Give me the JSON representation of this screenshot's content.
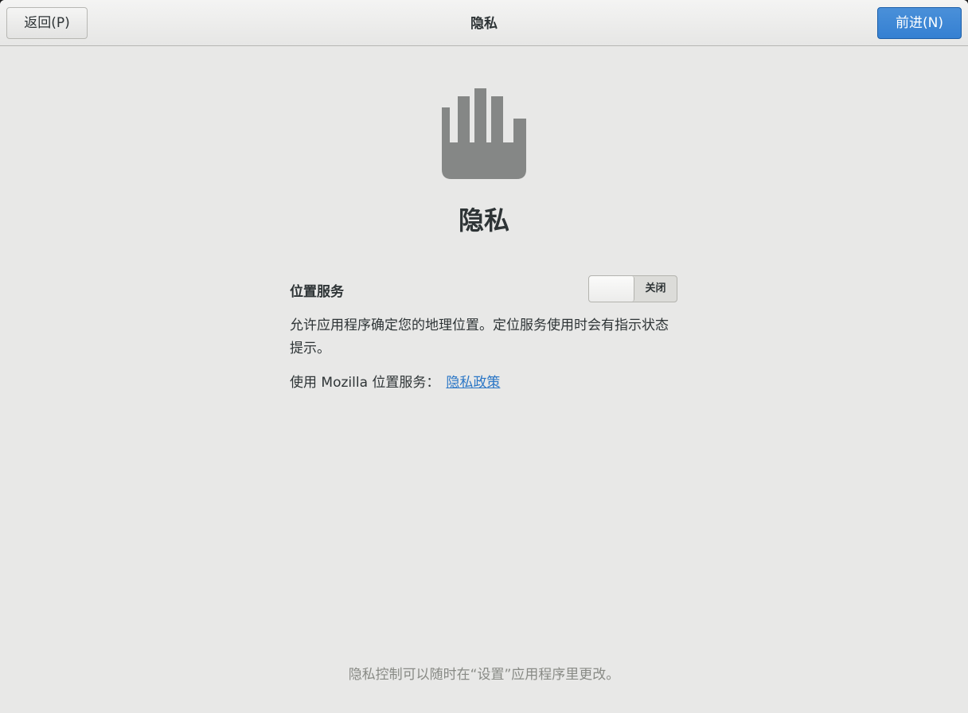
{
  "header": {
    "title": "隐私",
    "back_label": "返回(P)",
    "next_label": "前进(N)"
  },
  "page": {
    "icon": "hand-stop-icon",
    "title": "隐私"
  },
  "location_services": {
    "label": "位置服务",
    "switch_state_label": "关闭",
    "description": "允许应用程序确定您的地理位置。定位服务使用时会有指示状态提示。",
    "mozilla_prefix": "使用 Mozilla 位置服务：",
    "policy_link": "隐私政策"
  },
  "footer": {
    "note": "隐私控制可以随时在“设置”应用程序里更改。"
  },
  "colors": {
    "accent": "#3584e4",
    "link": "#2a76c6",
    "background": "#e8e8e7",
    "icon": "#858786"
  }
}
